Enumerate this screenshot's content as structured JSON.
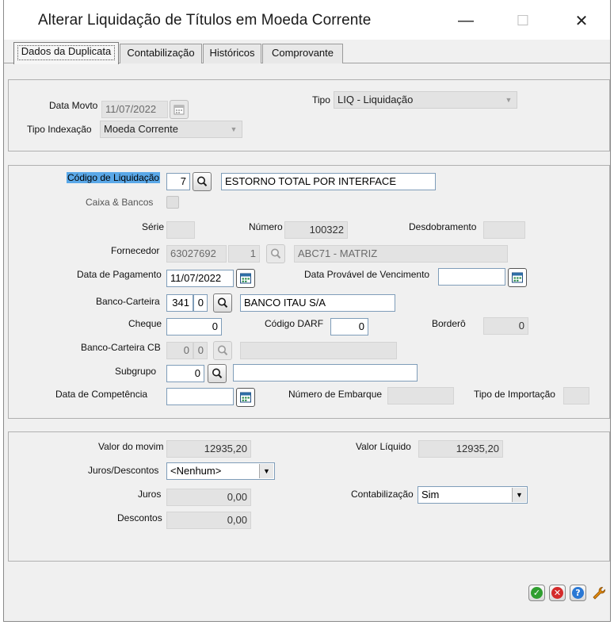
{
  "window": {
    "title": "Alterar Liquidação de Títulos em Moeda Corrente",
    "minimize_glyph": "—",
    "maximize_glyph": "☐",
    "close_glyph": "✕"
  },
  "tabs": [
    {
      "label": "Dados da Duplicata",
      "active": true
    },
    {
      "label": "Contabilização",
      "active": false
    },
    {
      "label": "Históricos",
      "active": false
    },
    {
      "label": "Comprovante",
      "active": false
    }
  ],
  "section1": {
    "data_movto_label": "Data Movto",
    "data_movto_value": "11/07/2022",
    "tipo_indexacao_label": "Tipo Indexação",
    "tipo_indexacao_value": "Moeda Corrente",
    "tipo_label": "Tipo",
    "tipo_value": "LIQ - Liquidação"
  },
  "section2": {
    "codigo_liquidacao_label": "Código de Liquidação",
    "codigo_liquidacao_value": "7",
    "codigo_liquidacao_desc": "ESTORNO TOTAL POR INTERFACE",
    "caixa_bancos_label": "Caixa & Bancos",
    "serie_label": "Série",
    "serie_value": "",
    "numero_label": "Número",
    "numero_value": "100322",
    "desdobramento_label": "Desdobramento",
    "desdobramento_value": "",
    "fornecedor_label": "Fornecedor",
    "fornecedor_code": "63027692",
    "fornecedor_loja": "1",
    "fornecedor_name": "ABC71 - MATRIZ",
    "data_pagamento_label": "Data de Pagamento",
    "data_pagamento_value": "11/07/2022",
    "data_provavel_label": "Data Provável de Vencimento",
    "data_provavel_value": "",
    "banco_carteira_label": "Banco-Carteira",
    "banco_code": "341",
    "carteira_code": "0",
    "banco_name": "BANCO ITAU S/A",
    "cheque_label": "Cheque",
    "cheque_value": "0",
    "codigo_darf_label": "Código DARF",
    "codigo_darf_value": "0",
    "bordero_label": "Borderô",
    "bordero_value": "0",
    "banco_carteira_cb_label": "Banco-Carteira CB",
    "banco_cb_code": "0",
    "carteira_cb_code": "0",
    "banco_cb_name": "",
    "subgrupo_label": "Subgrupo",
    "subgrupo_value": "0",
    "subgrupo_desc": "",
    "data_competencia_label": "Data de Competência",
    "data_competencia_value": "",
    "numero_embarque_label": "Número de Embarque",
    "numero_embarque_value": "",
    "tipo_importacao_label": "Tipo de Importação",
    "tipo_importacao_value": ""
  },
  "section3": {
    "valor_movimento_label": "Valor do movim",
    "valor_movimento_value": "12935,20",
    "valor_liquido_label": "Valor Líquido",
    "valor_liquido_value": "12935,20",
    "juros_descontos_label": "Juros/Descontos",
    "juros_descontos_value": "<Nenhum>",
    "juros_label": "Juros",
    "juros_value": "0,00",
    "descontos_label": "Descontos",
    "descontos_value": "0,00",
    "contabilizacao_label": "Contabilização",
    "contabilizacao_value": "Sim"
  },
  "footer": {
    "ok_glyph": "✓",
    "cancel_glyph": "✕",
    "help_glyph": "?",
    "tools_glyph": "✎"
  },
  "colors": {
    "ok": "#2f9e2f",
    "cancel": "#d42a2a",
    "help": "#2a78d4",
    "tools": "#e08a10",
    "selection": "#5aa8e8"
  }
}
